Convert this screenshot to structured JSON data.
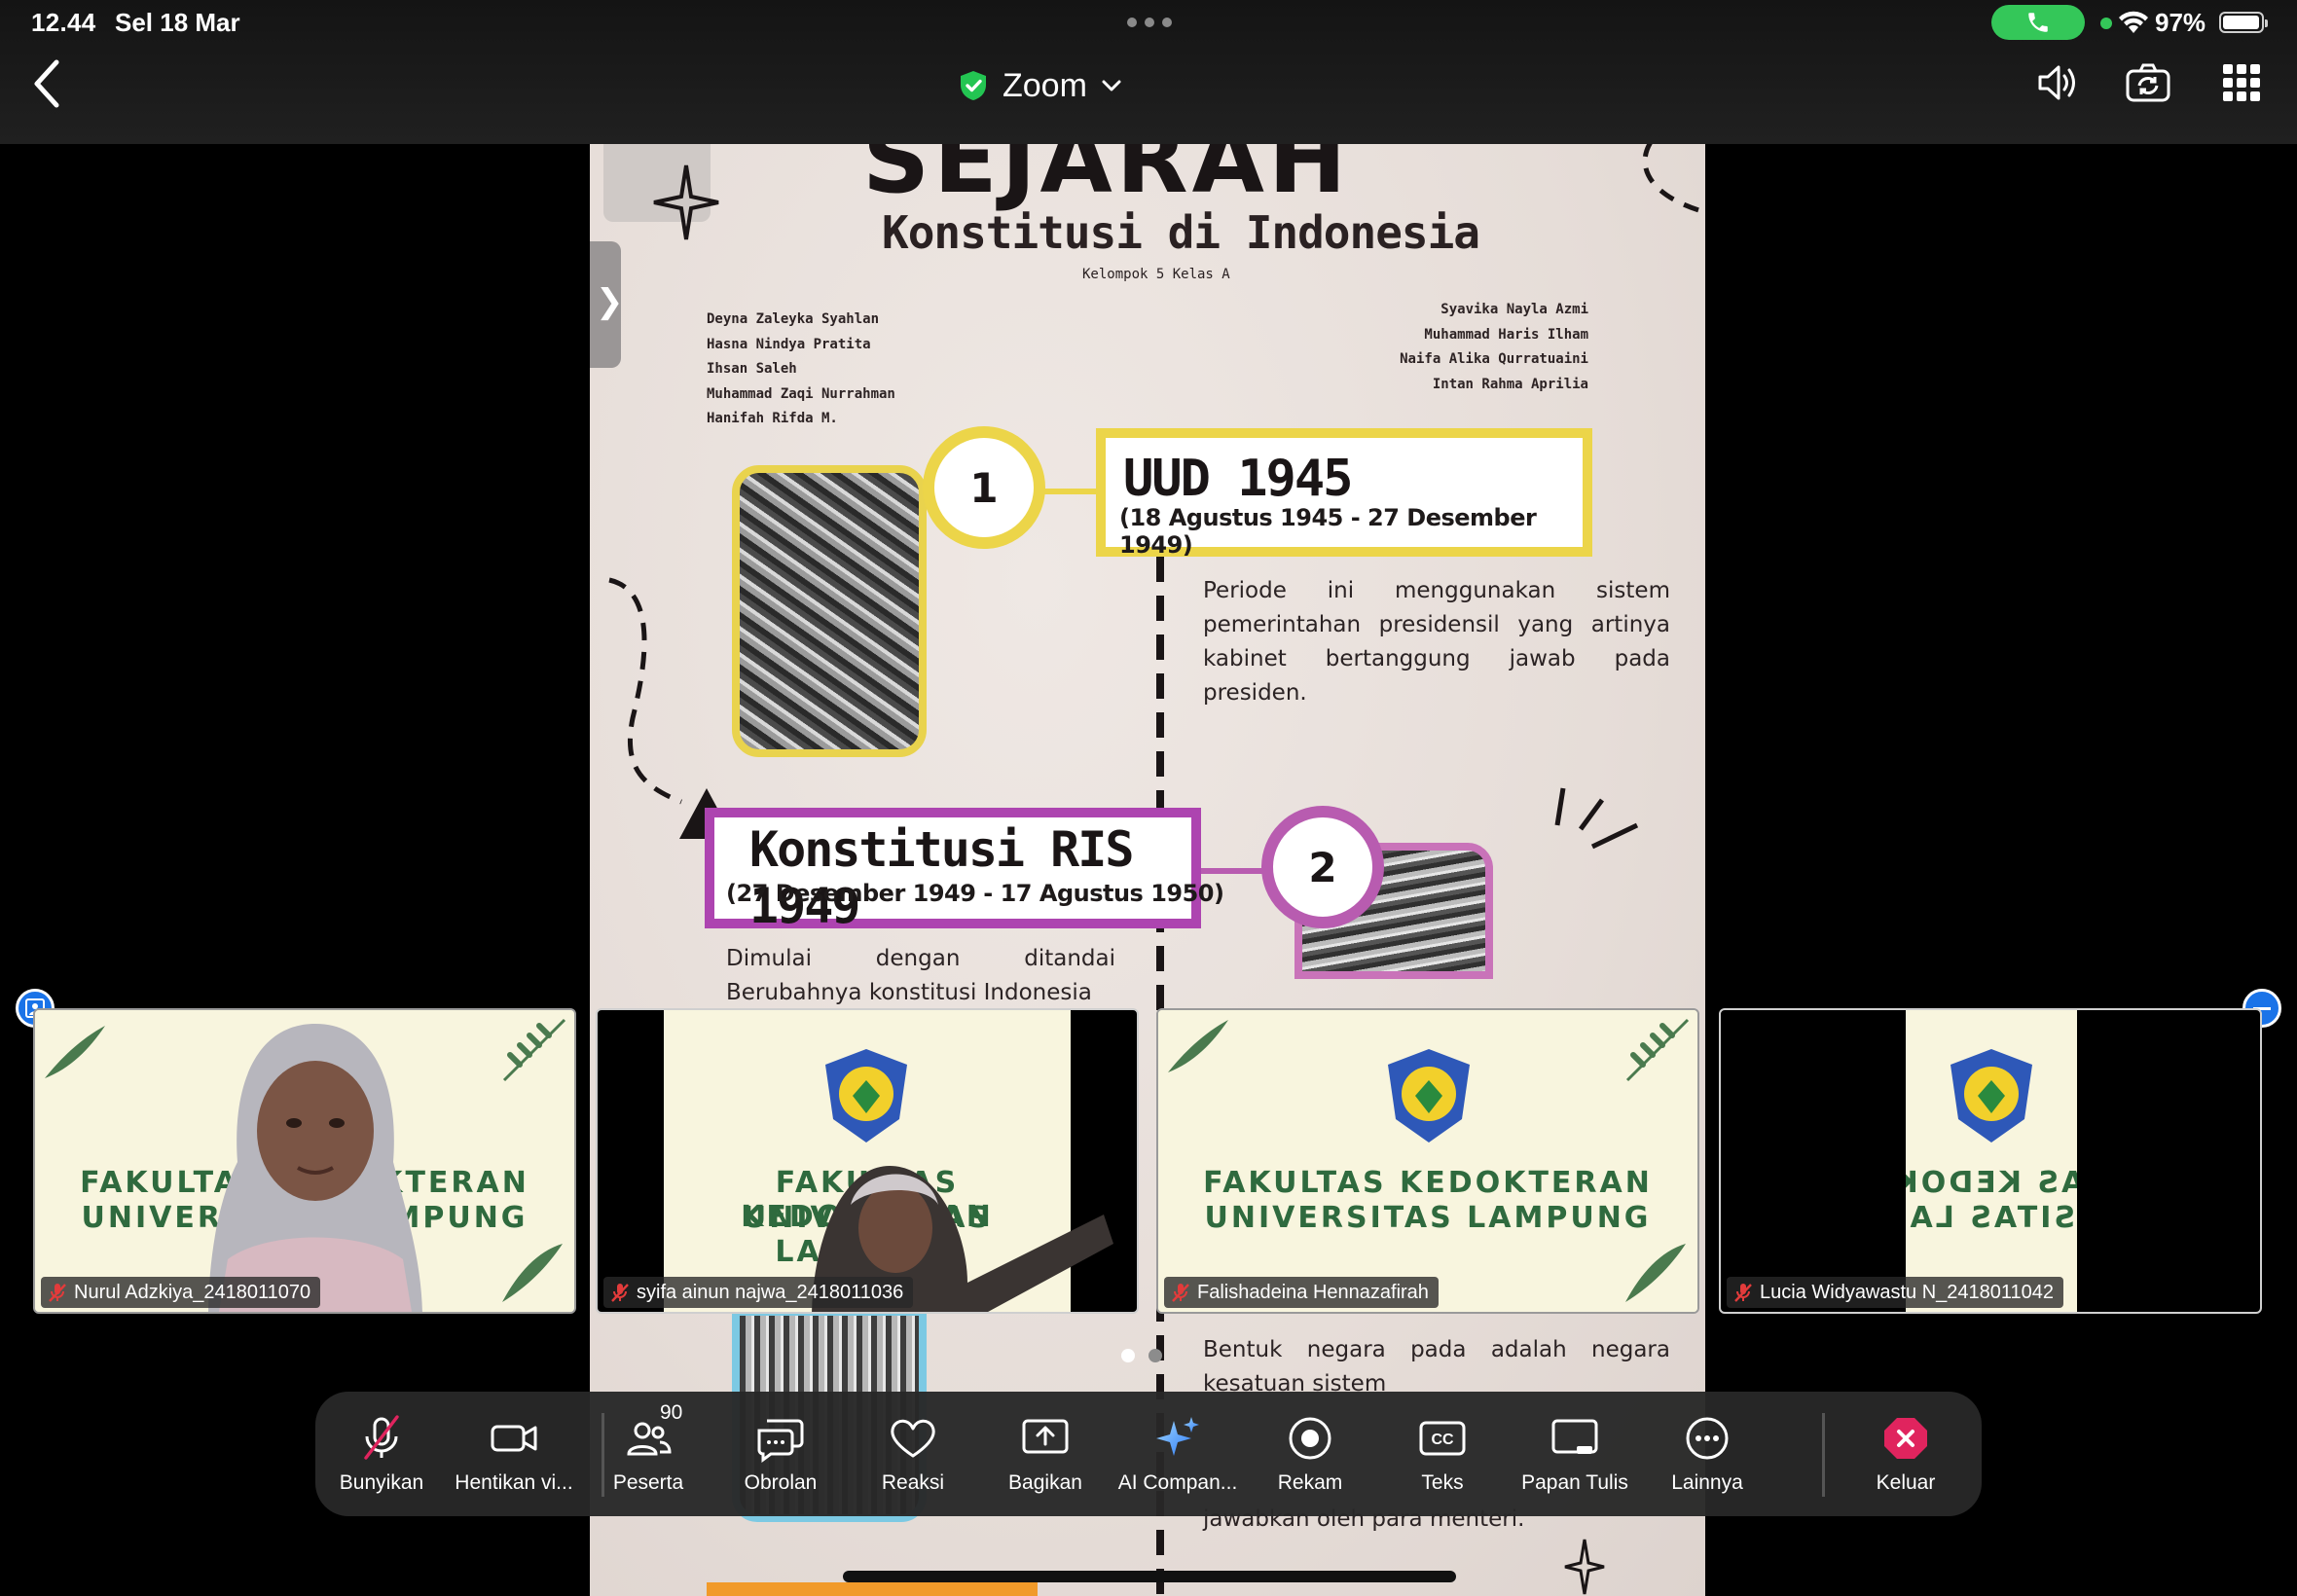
{
  "status_bar": {
    "time": "12.44",
    "date": "Sel 18 Mar",
    "battery_percent": "97%",
    "battery_level": 0.97,
    "call_color": "#34c759"
  },
  "header": {
    "title": "Zoom",
    "icons": [
      "back-icon",
      "shield-check-icon",
      "chevron-down-icon",
      "speaker-icon",
      "camera-switch-icon",
      "grid-view-icon"
    ]
  },
  "slide": {
    "title": "SEJARAH",
    "subtitle": "Konstitusi di Indonesia",
    "group": "Kelompok 5 Kelas A",
    "members_left": [
      "Deyna Zaleyka Syahlan",
      "Hasna Nindya Pratita",
      "Ihsan Saleh",
      "Muhammad Zaqi Nurrahman",
      "Hanifah Rifda M."
    ],
    "members_right": [
      "Syavika Nayla Azmi",
      "Muhammad Haris Ilham",
      "Naifa Alika Qurratuaini",
      "Intan Rahma Aprilia"
    ],
    "section1": {
      "number": "1",
      "heading": "UUD 1945",
      "dates": "(18 Agustus 1945 - 27 Desember 1949)",
      "text": "Periode ini menggunakan sistem pemerintahan presidensil yang artinya kabinet bertanggung jawab pada presiden.",
      "color": "#ecd549"
    },
    "section2": {
      "number": "2",
      "heading": "Konstitusi RIS 1949",
      "dates": "(27 Desember 1949 - 17 Agustus 1950)",
      "text": "Dimulai dengan ditandai Berubahnya konstitusi Indonesia",
      "color": "#ad44b0"
    },
    "section3": {
      "text": "Bentuk negara pada adalah negara kesatuan sistem",
      "text_end": "jawabkan oleh para menteri.",
      "color": "#7cc9e3"
    }
  },
  "participants": [
    {
      "name": "Nurul Adzkiya_2418011070",
      "muted": true,
      "background_text": [
        "FAKULTAS KEDOKTERAN",
        "UNIVERSITAS LAMPUNG"
      ]
    },
    {
      "name": "syifa ainun najwa_2418011036",
      "muted": true,
      "background_text": [
        "FAKULTAS KEDOKTERAN",
        "UNIVERSITAS LAMPUNG"
      ]
    },
    {
      "name": "Falishadeina Hennazafirah",
      "muted": true,
      "background_text": [
        "FAKULTAS KEDOKTERAN",
        "UNIVERSITAS LAMPUNG"
      ]
    },
    {
      "name": "Lucia Widyawastu N_2418011042",
      "muted": true,
      "background_text": [
        "FAKULTAS KEDOKTERAN",
        "UNIVERSITAS LAMPUNG"
      ]
    }
  ],
  "toolbar": {
    "items": [
      {
        "label": "Bunyikan",
        "icon": "mic-muted-icon"
      },
      {
        "label": "Hentikan vi...",
        "icon": "video-camera-icon"
      },
      {
        "label": "Peserta",
        "icon": "participants-icon",
        "badge": "90"
      },
      {
        "label": "Obrolan",
        "icon": "chat-icon"
      },
      {
        "label": "Reaksi",
        "icon": "heart-icon"
      },
      {
        "label": "Bagikan",
        "icon": "share-screen-icon"
      },
      {
        "label": "AI Compan...",
        "icon": "ai-sparkle-icon"
      },
      {
        "label": "Rekam",
        "icon": "record-icon"
      },
      {
        "label": "Teks",
        "icon": "cc-icon"
      },
      {
        "label": "Papan Tulis",
        "icon": "whiteboard-icon"
      },
      {
        "label": "Lainnya",
        "icon": "more-icon"
      },
      {
        "label": "Keluar",
        "icon": "leave-icon",
        "color": "#e0245e"
      }
    ]
  }
}
